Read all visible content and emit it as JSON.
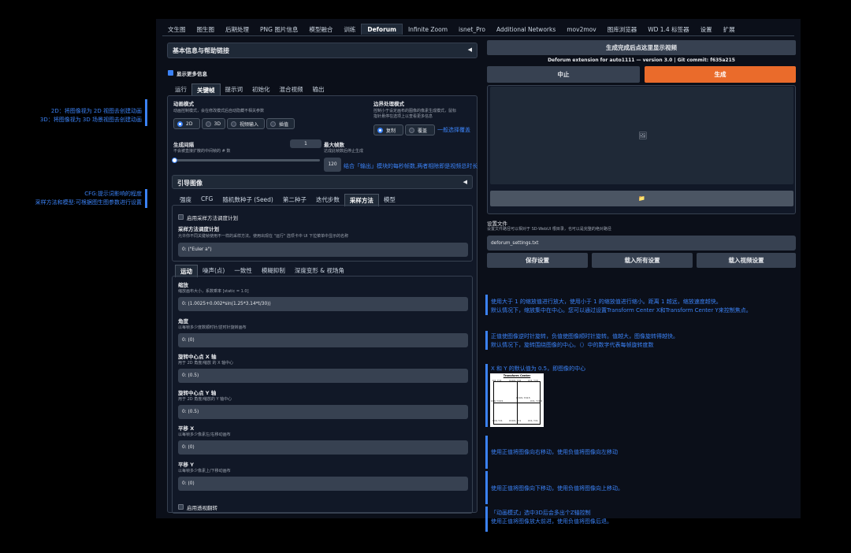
{
  "top_tabs": [
    "文生图",
    "图生图",
    "后期处理",
    "PNG 图片信息",
    "模型融合",
    "训练",
    "Deforum",
    "Infinite Zoom",
    "isnet_Pro",
    "Additional Networks",
    "mov2mov",
    "图库浏览器",
    "WD 1.4 标签器",
    "设置",
    "扩展"
  ],
  "info_accordion": "基本信息与帮助链接",
  "show_more_info": "显示更多信息",
  "deforum_tabs": [
    "运行",
    "关键帧",
    "提示词",
    "初始化",
    "混合视频",
    "输出"
  ],
  "animation_mode": {
    "label": "动画模式",
    "desc": "动画控制模式，会在修改模式后自动隐藏不相关参数",
    "options": [
      "2D",
      "3D",
      "视频输入",
      "插值"
    ]
  },
  "border": {
    "label": "边界处理模式",
    "desc1": "控制小于设定画布的图像的像素生成模式，鼠标",
    "desc2": "指针悬停在选项上以查看更多信息",
    "options": [
      "复制",
      "覆盖"
    ]
  },
  "cadence": {
    "label": "生成间隔",
    "desc": "不会被直接扩散的中间帧的 # 数",
    "value": "1"
  },
  "max_frames": {
    "label": "最大帧数",
    "desc": "达成此帧数后停止生成",
    "value": "120"
  },
  "guided_accordion": "引导图像",
  "sampler_tabs": [
    "强度",
    "CFG",
    "随机数种子 (Seed)",
    "第二种子",
    "迭代步数",
    "采样方法",
    "模型"
  ],
  "enable_sampler_schedule": "启用采样方法调度计划",
  "sampler_schedule": {
    "label": "采样方法调度计划",
    "desc": "允许你不同关键帧使用不一样的采样方法。使用出现在 \"运行\" 选项卡中 UI 下拉菜单中显示的名称",
    "value": "0: (\"Euler a\")"
  },
  "motion_tabs": [
    "运动",
    "噪声(点)",
    "一致性",
    "模糊抑制",
    "深度变形 & 视场角"
  ],
  "motion_fields": [
    {
      "label": "缩放",
      "desc": "缩放画布大小，系数乘率 [static = 1.0]",
      "value": "0: (1.0025+0.002*sin(1.25*3.14*t/30))"
    },
    {
      "label": "角度",
      "desc": "以每帧多少度数顺时针/逆时针旋转画布",
      "value": "0: (0)"
    },
    {
      "label": "旋转中心点 X 轴",
      "desc": "用于 2D 角度/缩放 的 X 轴中心",
      "value": "0: (0.5)"
    },
    {
      "label": "旋转中心点 Y 轴",
      "desc": "用于 2D 角度/缩放的 Y 轴中心",
      "value": "0: (0.5)"
    },
    {
      "label": "平移 X",
      "desc": "以每帧多少像素左/右移动画布",
      "value": "0: (0)"
    },
    {
      "label": "平移 Y",
      "desc": "以每帧多少像素上/下移动画布",
      "value": "0: (0)"
    }
  ],
  "enable_perspective": "启用透视翻转",
  "right": {
    "show_video_btn": "生成完成后点这里显示视频",
    "version": "Deforum extension for auto1111 — version 3.0 | Git commit: f635a215",
    "stop": "中止",
    "generate": "生成",
    "settings_label": "设置文件",
    "settings_desc": "设置文件路径可以相对于 SD-WebUI 根目录，也可以是完整的绝对路径",
    "settings_value": "deforum_settings.txt",
    "save": "保存设置",
    "load_all": "载入所有设置",
    "load_video": "载入视频设置"
  },
  "notes": {
    "left1": "2D：将图像视为 2D 视图去创建动画",
    "left2": "3D：将图像视为 3D 场景视图去创建动画",
    "left3": "CFG:提示词影响的程度",
    "left4": "采样方法和模型:可根据图生图参数进行设置",
    "border_note": "一般选择覆盖",
    "frames_note": "结合「输出」模块的每秒帧数,两者相除即是视频总时长",
    "zoom1": "使用大于 1 的缩放值进行放大，使用小于 1 的缩放值进行缩小。距离 1 越远，缩放速度越快。",
    "zoom2": "默认情况下，缩放集中在中心。您可以通过设置Transform Center X和Transform Center Y来控制焦点。",
    "angle1": "正值使图像逆时针旋转，负值使图像顺时针旋转。值越大，图像旋转得越快。",
    "angle2": "默认情况下，旋转围绕图像的中心。（）中的数字代表每帧旋转度数",
    "center": "X 和 Y 的默认值为 0.5，即图像的中心",
    "diagram_title": "Transform Center",
    "diagram_labels": [
      "0,0; Y=0",
      "X=0.5, Y=0",
      "X=1, Y=0",
      "X=0.5, Y=0.5",
      "X=0, Y=0.5",
      "X=1, Y=0.5",
      "X=0, Y=1",
      "X=0.5, Y=1",
      "X=1, Y=1"
    ],
    "tx": "使用正值将图像向右移动，使用负值将图像向左移动",
    "ty": "使用正值将图像向下移动，使用负值将图像向上移动。",
    "tz1": "「动画模式」选中3D后会多出个Z轴控制",
    "tz2": "使用正值将图像放大前进，使用负值将图像后退。"
  }
}
